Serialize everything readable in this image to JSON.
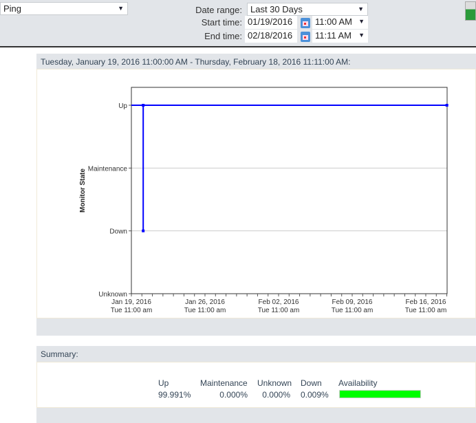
{
  "toolbar": {
    "monitor_select": "Ping",
    "date_range_label": "Date range:",
    "date_range_value": "Last 30 Days",
    "start_label": "Start time:",
    "start_date": "01/19/2016",
    "start_time": "11:00 AM",
    "end_label": "End time:",
    "end_date": "02/18/2016",
    "end_time": "11:11 AM",
    "chart_icon": "chart-icon"
  },
  "chart_panel": {
    "title": "Tuesday, January 19, 2016 11:00:00 AM - Thursday, February 18, 2016 11:11:00 AM:"
  },
  "chart_data": {
    "type": "line",
    "ylabel": "Monitor State",
    "xlabel": "",
    "title": "",
    "y_categories": [
      "Unknown",
      "Down",
      "Maintenance",
      "Up"
    ],
    "x_range": [
      "2016-01-19 11:00",
      "2016-02-18 11:11"
    ],
    "x_ticks": [
      {
        "date": "2016-01-19 11:00",
        "l1": "Jan 19, 2016",
        "l2": "Tue 11:00 am"
      },
      {
        "date": "2016-01-26 11:00",
        "l1": "Jan 26, 2016",
        "l2": "Tue 11:00 am"
      },
      {
        "date": "2016-02-02 11:00",
        "l1": "Feb 02, 2016",
        "l2": "Tue 11:00 am"
      },
      {
        "date": "2016-02-09 11:00",
        "l1": "Feb 09, 2016",
        "l2": "Tue 11:00 am"
      },
      {
        "date": "2016-02-16 11:00",
        "l1": "Feb 16, 2016",
        "l2": "Tue 11:00 am"
      }
    ],
    "grid": true,
    "color": "#0000ff",
    "points": [
      [
        "2016-01-19 11:00",
        "Up"
      ],
      [
        "2016-01-20 14:00",
        "Up"
      ],
      [
        "2016-01-20 14:00",
        "Down"
      ],
      [
        "2016-01-20 14:00",
        "Up"
      ],
      [
        "2016-02-18 11:11",
        "Up"
      ]
    ],
    "markers": [
      [
        "2016-01-20 14:00",
        "Up"
      ],
      [
        "2016-01-20 14:00",
        "Down"
      ],
      [
        "2016-02-18 11:11",
        "Up"
      ]
    ]
  },
  "summary": {
    "title": "Summary:",
    "headers": [
      "Up",
      "Maintenance",
      "Unknown",
      "Down",
      "Availability"
    ],
    "values": [
      "99.991%",
      "0.000%",
      "0.000%",
      "0.009%"
    ],
    "availability": 0.99991,
    "availability_color": "#00ff00"
  }
}
